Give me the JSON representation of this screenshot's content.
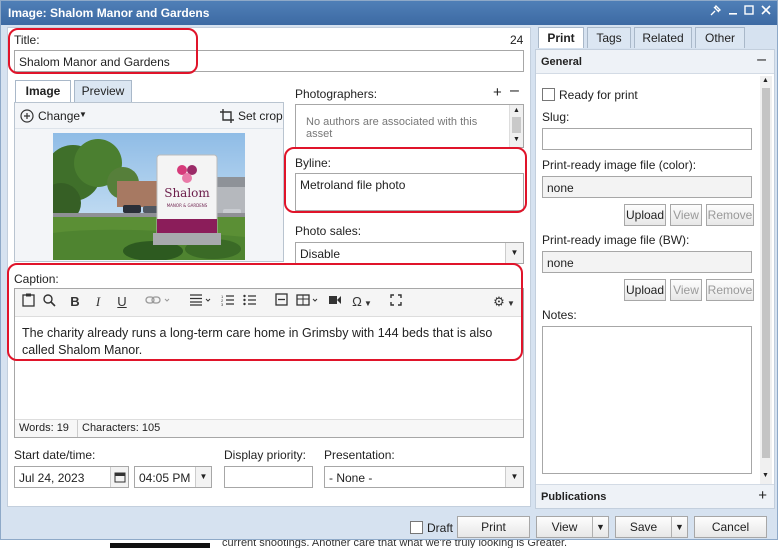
{
  "window": {
    "title": "Image: Shalom Manor and Gardens"
  },
  "title_field": {
    "label": "Title:",
    "counter": "24",
    "value": "Shalom Manor and Gardens"
  },
  "media_tabs": [
    "Image",
    "Preview"
  ],
  "image_toolbar": {
    "change_label": "Change",
    "set_crop_label": "Set crop"
  },
  "image": {
    "sign_text": "Shalom",
    "sign_subtext": "MANOR & GARDENS"
  },
  "photographers": {
    "label": "Photographers:",
    "empty_text": "No authors are associated with this asset"
  },
  "byline": {
    "label": "Byline:",
    "value": "Metroland file photo"
  },
  "photo_sales": {
    "label": "Photo sales:",
    "value": "Disable"
  },
  "caption": {
    "label": "Caption:",
    "text": "The charity already runs a long-term care home in Grimsby with 144 beds that is also called Shalom Manor.",
    "words_label": "Words: 19",
    "chars_label": "Characters: 105"
  },
  "start": {
    "label": "Start date/time:",
    "date": "Jul 24, 2023",
    "time": "04:05 PM"
  },
  "display_priority": {
    "label": "Display priority:",
    "value": ""
  },
  "presentation": {
    "label": "Presentation:",
    "value": "- None -"
  },
  "right_tabs": [
    "Print",
    "Tags",
    "Related",
    "Other"
  ],
  "general": {
    "header": "General",
    "ready_for_print": "Ready for print",
    "slug_label": "Slug:",
    "slug_value": "",
    "color_label": "Print-ready image file (color):",
    "color_value": "none",
    "bw_label": "Print-ready image file (BW):",
    "bw_value": "none",
    "upload": "Upload",
    "view": "View",
    "remove": "Remove",
    "notes_label": "Notes:"
  },
  "publications": {
    "header": "Publications"
  },
  "footer": {
    "draft": "Draft",
    "print": "Print",
    "view": "View",
    "save": "Save",
    "cancel": "Cancel"
  },
  "background_text": "current shootings. Another care that what we're truly looking is Greater."
}
